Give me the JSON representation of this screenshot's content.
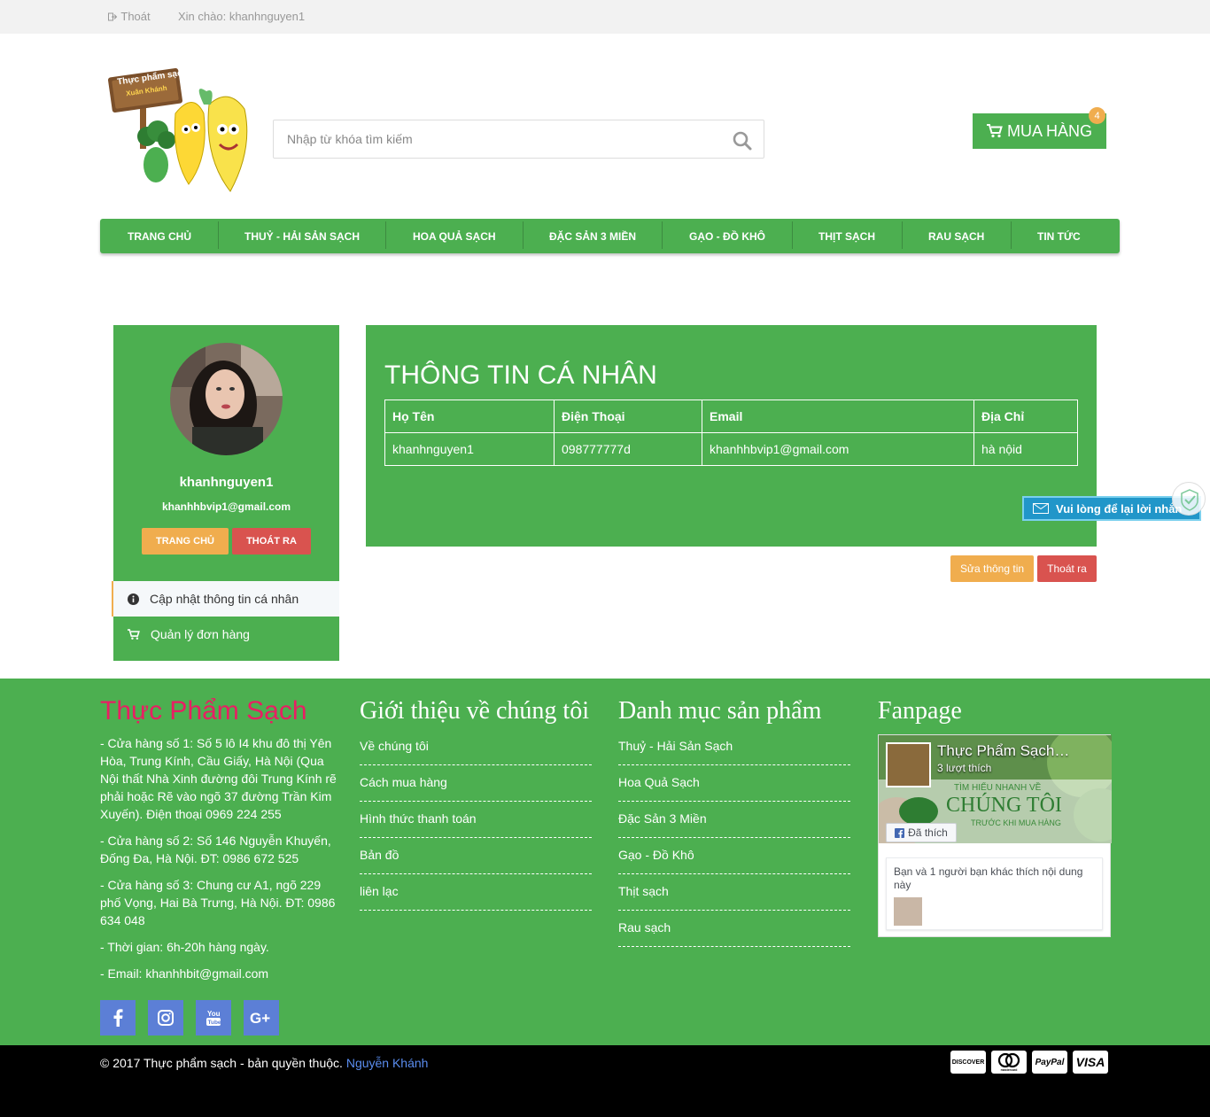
{
  "topbar": {
    "logout": "Thoát",
    "greeting": "Xin chào: khanhnguyen1"
  },
  "logo": {
    "line1": "Thực phẩm sạch",
    "line2": "Xuân Khánh"
  },
  "search": {
    "placeholder": "Nhập từ khóa tìm kiếm"
  },
  "cart": {
    "label": "MUA HÀNG",
    "count": "4"
  },
  "nav": {
    "items": [
      "TRANG CHỦ",
      "THUỶ - HẢI SẢN SẠCH",
      "HOA QUẢ SẠCH",
      "ĐẶC SẢN 3 MIỀN",
      "GẠO - ĐỒ KHÔ",
      "THỊT SẠCH",
      "RAU SẠCH",
      "TIN TỨC"
    ]
  },
  "sidebar": {
    "username": "khanhnguyen1",
    "email": "khanhhbvip1@gmail.com",
    "home_button": "TRANG CHỦ",
    "exit_button": "THOÁT RA",
    "menu": [
      "Cập nhật thông tin cá nhân",
      "Quản lý đơn hàng"
    ]
  },
  "profile": {
    "title": "THÔNG TIN CÁ NHÂN",
    "headers": [
      "Họ Tên",
      "Điện Thoại",
      "Email",
      "Địa Chỉ"
    ],
    "row": [
      "khanhnguyen1",
      "098777777d",
      "khanhhbvip1@gmail.com",
      "hà nộid"
    ],
    "edit_button": "Sửa thông tin",
    "exit_button": "Thoát ra"
  },
  "chat_widget": {
    "label": "Vui lòng để lại lời nhắn"
  },
  "footer": {
    "brand": "Thực Phẩm Sạch",
    "address": [
      "- Cửa hàng số 1: Số 5 lô I4 khu đô thị Yên Hòa, Trung Kính, Cầu Giấy, Hà Nội (Qua Nội thất Nhà Xinh đường đôi Trung Kính rẽ phải hoặc Rẽ vào ngõ 37 đường Trần Kim Xuyến). Điện thoại 0969 224 255",
      "- Cửa hàng số 2: Số 146 Nguyễn Khuyến, Đống Đa, Hà Nội. ĐT: 0986 672 525",
      "- Cửa hàng số 3: Chung cư A1, ngõ 229 phố Vọng, Hai Bà Trưng, Hà Nội. ĐT: 0986 634 048",
      "- Thời gian: 6h-20h hàng ngày.",
      "- Email: khanhhbit@gmail.com"
    ],
    "about": {
      "title": "Giới thiệu về chúng tôi",
      "links": [
        "Về chúng tôi",
        "Cách mua hàng",
        "Hình thức thanh toán",
        "Bản đồ",
        "liên lạc"
      ]
    },
    "categories": {
      "title": "Danh mục sản phẩm",
      "links": [
        "Thuỷ - Hải Sản Sạch",
        "Hoa Quả Sạch",
        "Đặc Sản 3 Miền",
        "Gạo - Đồ Khô",
        "Thịt sạch",
        "Rau sạch"
      ]
    },
    "fanpage": {
      "title": "Fanpage",
      "page_name": "Thực Phẩm Sạch…",
      "likes": "3 lượt thích",
      "banner_small": "TÌM HIỂU NHANH VỀ",
      "banner_big": "CHÚNG TÔI",
      "banner_sub": "TRƯỚC KHI MUA HÀNG",
      "liked_button": "Đã thích",
      "friends_text": "Bạn và 1 người bạn khác thích nội dung này"
    },
    "socials": [
      "facebook-icon",
      "instagram-icon",
      "youtube-icon",
      "google-plus-icon"
    ]
  },
  "bottom": {
    "copyright": "© 2017 Thực phẩm sạch - bản quyền thuộc.",
    "author": "Nguyễn Khánh",
    "cards": [
      "DISCOVER",
      "mastercard",
      "PayPal",
      "VISA"
    ]
  },
  "colors": {
    "green": "#4caf50",
    "orange": "#f0ad4e",
    "red": "#d9534f",
    "pink": "#e91e63",
    "blue": "#2196c9"
  }
}
